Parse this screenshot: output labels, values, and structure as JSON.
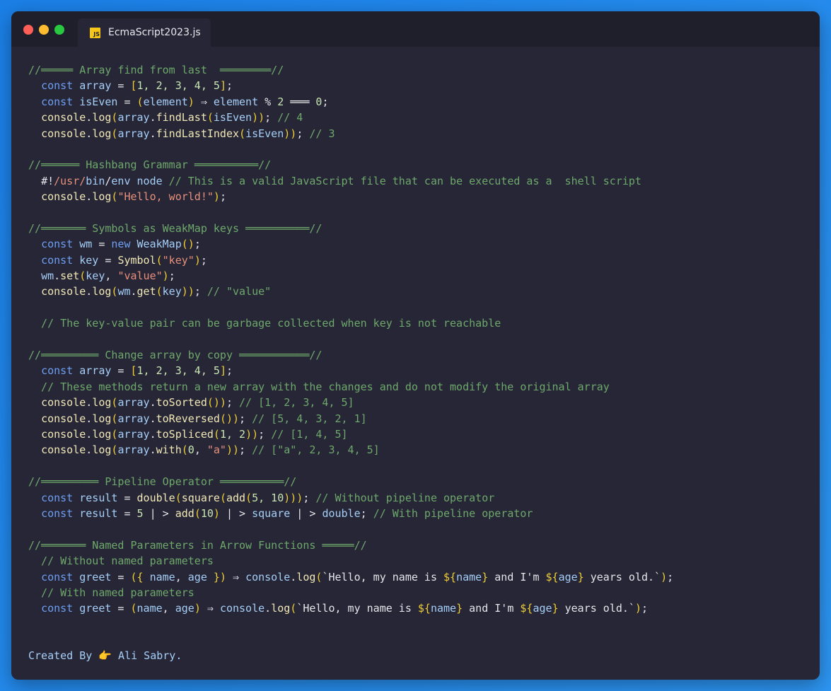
{
  "window": {
    "tab_title": "EcmaScript2023.js",
    "tab_icon": "JS"
  },
  "colors": {
    "background": "#2d96f3",
    "editor_bg": "#262637",
    "titlebar_bg": "#1f1f2c",
    "comment": "#6ea86a",
    "keyword": "#6e9ff2",
    "identifier": "#a6cff7",
    "plain": "#e6e6ea",
    "bracket": "#f0cf35",
    "string": "#e8907a",
    "method": "#f2e8b6",
    "number": "#c9e6b2"
  },
  "code_lines": [
    [
      [
        "//═════ Array find from last  ════════//",
        "comment"
      ]
    ],
    [
      [
        "  ",
        "plain"
      ],
      [
        "const",
        "keyword"
      ],
      [
        " ",
        "plain"
      ],
      [
        "array",
        "identifier"
      ],
      [
        " = ",
        "plain"
      ],
      [
        "[",
        "bracket"
      ],
      [
        "1, 2, 3, 4, 5",
        "number"
      ],
      [
        "]",
        "bracket"
      ],
      [
        ";",
        "plain"
      ]
    ],
    [
      [
        "  ",
        "plain"
      ],
      [
        "const",
        "keyword"
      ],
      [
        " ",
        "plain"
      ],
      [
        "isEven",
        "identifier"
      ],
      [
        " = ",
        "plain"
      ],
      [
        "(",
        "bracket"
      ],
      [
        "element",
        "identifier"
      ],
      [
        ")",
        "bracket"
      ],
      [
        " ⇒ ",
        "plain"
      ],
      [
        "element",
        "identifier"
      ],
      [
        " % ",
        "plain"
      ],
      [
        "2",
        "number"
      ],
      [
        " ═══ ",
        "plain"
      ],
      [
        "0",
        "number"
      ],
      [
        ";",
        "plain"
      ]
    ],
    [
      [
        "  ",
        "plain"
      ],
      [
        "console",
        "method"
      ],
      [
        ".",
        "plain"
      ],
      [
        "log",
        "method"
      ],
      [
        "(",
        "bracket"
      ],
      [
        "array",
        "identifier"
      ],
      [
        ".",
        "plain"
      ],
      [
        "findLast",
        "method"
      ],
      [
        "(",
        "bracket"
      ],
      [
        "isEven",
        "identifier"
      ],
      [
        "))",
        "bracket"
      ],
      [
        "; ",
        "plain"
      ],
      [
        "// 4",
        "comment"
      ]
    ],
    [
      [
        "  ",
        "plain"
      ],
      [
        "console",
        "method"
      ],
      [
        ".",
        "plain"
      ],
      [
        "log",
        "method"
      ],
      [
        "(",
        "bracket"
      ],
      [
        "array",
        "identifier"
      ],
      [
        ".",
        "plain"
      ],
      [
        "findLastIndex",
        "method"
      ],
      [
        "(",
        "bracket"
      ],
      [
        "isEven",
        "identifier"
      ],
      [
        "))",
        "bracket"
      ],
      [
        "; ",
        "plain"
      ],
      [
        "// 3",
        "comment"
      ]
    ],
    [],
    [
      [
        "//══════ Hashbang Grammar ══════════//",
        "comment"
      ]
    ],
    [
      [
        "  ",
        "plain"
      ],
      [
        "#!",
        "plain"
      ],
      [
        "/usr/",
        "string"
      ],
      [
        "bin",
        "identifier"
      ],
      [
        "/",
        "plain"
      ],
      [
        "env",
        "identifier"
      ],
      [
        " ",
        "plain"
      ],
      [
        "node",
        "identifier"
      ],
      [
        " // This is a valid JavaScript file that can be executed as a  shell script",
        "comment"
      ]
    ],
    [
      [
        "  ",
        "plain"
      ],
      [
        "console",
        "method"
      ],
      [
        ".",
        "plain"
      ],
      [
        "log",
        "method"
      ],
      [
        "(",
        "bracket"
      ],
      [
        "\"Hello, world!\"",
        "string"
      ],
      [
        ")",
        "bracket"
      ],
      [
        ";",
        "plain"
      ]
    ],
    [],
    [
      [
        "//═══════ Symbols as WeakMap keys ══════════//",
        "comment"
      ]
    ],
    [
      [
        "  ",
        "plain"
      ],
      [
        "const",
        "keyword"
      ],
      [
        " ",
        "plain"
      ],
      [
        "wm",
        "identifier"
      ],
      [
        " = ",
        "plain"
      ],
      [
        "new",
        "keyword"
      ],
      [
        " ",
        "plain"
      ],
      [
        "WeakMap",
        "identifier"
      ],
      [
        "()",
        "bracket"
      ],
      [
        ";",
        "plain"
      ]
    ],
    [
      [
        "  ",
        "plain"
      ],
      [
        "const",
        "keyword"
      ],
      [
        " ",
        "plain"
      ],
      [
        "key",
        "identifier"
      ],
      [
        " = ",
        "plain"
      ],
      [
        "Symbol",
        "method"
      ],
      [
        "(",
        "bracket"
      ],
      [
        "\"key\"",
        "string"
      ],
      [
        ")",
        "bracket"
      ],
      [
        ";",
        "plain"
      ]
    ],
    [
      [
        "  ",
        "plain"
      ],
      [
        "wm",
        "identifier"
      ],
      [
        ".",
        "plain"
      ],
      [
        "set",
        "method"
      ],
      [
        "(",
        "bracket"
      ],
      [
        "key",
        "identifier"
      ],
      [
        ", ",
        "plain"
      ],
      [
        "\"value\"",
        "string"
      ],
      [
        ")",
        "bracket"
      ],
      [
        ";",
        "plain"
      ]
    ],
    [
      [
        "  ",
        "plain"
      ],
      [
        "console",
        "method"
      ],
      [
        ".",
        "plain"
      ],
      [
        "log",
        "method"
      ],
      [
        "(",
        "bracket"
      ],
      [
        "wm",
        "identifier"
      ],
      [
        ".",
        "plain"
      ],
      [
        "get",
        "method"
      ],
      [
        "(",
        "bracket"
      ],
      [
        "key",
        "identifier"
      ],
      [
        "))",
        "bracket"
      ],
      [
        "; ",
        "plain"
      ],
      [
        "// \"value\"",
        "comment"
      ]
    ],
    [],
    [
      [
        "  // The key-value pair can be garbage collected when key is not reachable",
        "comment"
      ]
    ],
    [],
    [
      [
        "//═════════ Change array by copy ═══════════//",
        "comment"
      ]
    ],
    [
      [
        "  ",
        "plain"
      ],
      [
        "const",
        "keyword"
      ],
      [
        " ",
        "plain"
      ],
      [
        "array",
        "identifier"
      ],
      [
        " = ",
        "plain"
      ],
      [
        "[",
        "bracket"
      ],
      [
        "1, 2, 3, 4, 5",
        "number"
      ],
      [
        "]",
        "bracket"
      ],
      [
        ";",
        "plain"
      ]
    ],
    [
      [
        "  // These methods return a new array with the changes and do not modify the original array",
        "comment"
      ]
    ],
    [
      [
        "  ",
        "plain"
      ],
      [
        "console",
        "method"
      ],
      [
        ".",
        "plain"
      ],
      [
        "log",
        "method"
      ],
      [
        "(",
        "bracket"
      ],
      [
        "array",
        "identifier"
      ],
      [
        ".",
        "plain"
      ],
      [
        "toSorted",
        "method"
      ],
      [
        "())",
        "bracket"
      ],
      [
        "; ",
        "plain"
      ],
      [
        "// [1, 2, 3, 4, 5]",
        "comment"
      ]
    ],
    [
      [
        "  ",
        "plain"
      ],
      [
        "console",
        "method"
      ],
      [
        ".",
        "plain"
      ],
      [
        "log",
        "method"
      ],
      [
        "(",
        "bracket"
      ],
      [
        "array",
        "identifier"
      ],
      [
        ".",
        "plain"
      ],
      [
        "toReversed",
        "method"
      ],
      [
        "())",
        "bracket"
      ],
      [
        "; ",
        "plain"
      ],
      [
        "// [5, 4, 3, 2, 1]",
        "comment"
      ]
    ],
    [
      [
        "  ",
        "plain"
      ],
      [
        "console",
        "method"
      ],
      [
        ".",
        "plain"
      ],
      [
        "log",
        "method"
      ],
      [
        "(",
        "bracket"
      ],
      [
        "array",
        "identifier"
      ],
      [
        ".",
        "plain"
      ],
      [
        "toSpliced",
        "method"
      ],
      [
        "(",
        "bracket"
      ],
      [
        "1, 2",
        "number"
      ],
      [
        "))",
        "bracket"
      ],
      [
        "; ",
        "plain"
      ],
      [
        "// [1, 4, 5]",
        "comment"
      ]
    ],
    [
      [
        "  ",
        "plain"
      ],
      [
        "console",
        "method"
      ],
      [
        ".",
        "plain"
      ],
      [
        "log",
        "method"
      ],
      [
        "(",
        "bracket"
      ],
      [
        "array",
        "identifier"
      ],
      [
        ".",
        "plain"
      ],
      [
        "with",
        "method"
      ],
      [
        "(",
        "bracket"
      ],
      [
        "0",
        "number"
      ],
      [
        ", ",
        "plain"
      ],
      [
        "\"a\"",
        "string"
      ],
      [
        "))",
        "bracket"
      ],
      [
        "; ",
        "plain"
      ],
      [
        "// [\"a\", 2, 3, 4, 5]",
        "comment"
      ]
    ],
    [],
    [
      [
        "//═════════ Pipeline Operator ══════════//",
        "comment"
      ]
    ],
    [
      [
        "  ",
        "plain"
      ],
      [
        "const",
        "keyword"
      ],
      [
        " ",
        "plain"
      ],
      [
        "result",
        "identifier"
      ],
      [
        " = ",
        "plain"
      ],
      [
        "double",
        "method"
      ],
      [
        "(",
        "bracket"
      ],
      [
        "square",
        "method"
      ],
      [
        "(",
        "bracket"
      ],
      [
        "add",
        "method"
      ],
      [
        "(",
        "bracket"
      ],
      [
        "5, 10",
        "number"
      ],
      [
        ")))",
        "bracket"
      ],
      [
        "; ",
        "plain"
      ],
      [
        "// Without pipeline operator",
        "comment"
      ]
    ],
    [
      [
        "  ",
        "plain"
      ],
      [
        "const",
        "keyword"
      ],
      [
        " ",
        "plain"
      ],
      [
        "result",
        "identifier"
      ],
      [
        " = ",
        "plain"
      ],
      [
        "5",
        "number"
      ],
      [
        " | > ",
        "plain"
      ],
      [
        "add",
        "method"
      ],
      [
        "(",
        "bracket"
      ],
      [
        "10",
        "number"
      ],
      [
        ")",
        "bracket"
      ],
      [
        " | > ",
        "plain"
      ],
      [
        "square",
        "identifier"
      ],
      [
        " | > ",
        "plain"
      ],
      [
        "double",
        "identifier"
      ],
      [
        "; ",
        "plain"
      ],
      [
        "// With pipeline operator",
        "comment"
      ]
    ],
    [],
    [
      [
        "//═══════ Named Parameters in Arrow Functions ═════//",
        "comment"
      ]
    ],
    [
      [
        "  // Without named parameters",
        "comment"
      ]
    ],
    [
      [
        "  ",
        "plain"
      ],
      [
        "const",
        "keyword"
      ],
      [
        " ",
        "plain"
      ],
      [
        "greet",
        "identifier"
      ],
      [
        " = ",
        "plain"
      ],
      [
        "({",
        "bracket"
      ],
      [
        " ",
        "plain"
      ],
      [
        "name",
        "identifier"
      ],
      [
        ", ",
        "plain"
      ],
      [
        "age",
        "identifier"
      ],
      [
        " ",
        "plain"
      ],
      [
        "})",
        "bracket"
      ],
      [
        " ⇒ ",
        "plain"
      ],
      [
        "console",
        "identifier"
      ],
      [
        ".",
        "plain"
      ],
      [
        "log",
        "method"
      ],
      [
        "(",
        "bracket"
      ],
      [
        "`Hello, my name is ",
        "plain"
      ],
      [
        "${",
        "bracket"
      ],
      [
        "name",
        "identifier"
      ],
      [
        "}",
        "bracket"
      ],
      [
        " and I'm ",
        "plain"
      ],
      [
        "${",
        "bracket"
      ],
      [
        "age",
        "identifier"
      ],
      [
        "}",
        "bracket"
      ],
      [
        " years old.`",
        "plain"
      ],
      [
        ")",
        "bracket"
      ],
      [
        ";",
        "plain"
      ]
    ],
    [
      [
        "  // With named parameters",
        "comment"
      ]
    ],
    [
      [
        "  ",
        "plain"
      ],
      [
        "const",
        "keyword"
      ],
      [
        " ",
        "plain"
      ],
      [
        "greet",
        "identifier"
      ],
      [
        " = ",
        "plain"
      ],
      [
        "(",
        "bracket"
      ],
      [
        "name",
        "identifier"
      ],
      [
        ", ",
        "plain"
      ],
      [
        "age",
        "identifier"
      ],
      [
        ")",
        "bracket"
      ],
      [
        " ⇒ ",
        "plain"
      ],
      [
        "console",
        "identifier"
      ],
      [
        ".",
        "plain"
      ],
      [
        "log",
        "method"
      ],
      [
        "(",
        "bracket"
      ],
      [
        "`Hello, my name is ",
        "plain"
      ],
      [
        "${",
        "bracket"
      ],
      [
        "name",
        "identifier"
      ],
      [
        "}",
        "bracket"
      ],
      [
        " and I'm ",
        "plain"
      ],
      [
        "${",
        "bracket"
      ],
      [
        "age",
        "identifier"
      ],
      [
        "}",
        "bracket"
      ],
      [
        " years old.`",
        "plain"
      ],
      [
        ")",
        "bracket"
      ],
      [
        ";",
        "plain"
      ]
    ]
  ],
  "footer": {
    "prefix": "Created By ",
    "emoji": "👉",
    "author": " Ali Sabry."
  }
}
